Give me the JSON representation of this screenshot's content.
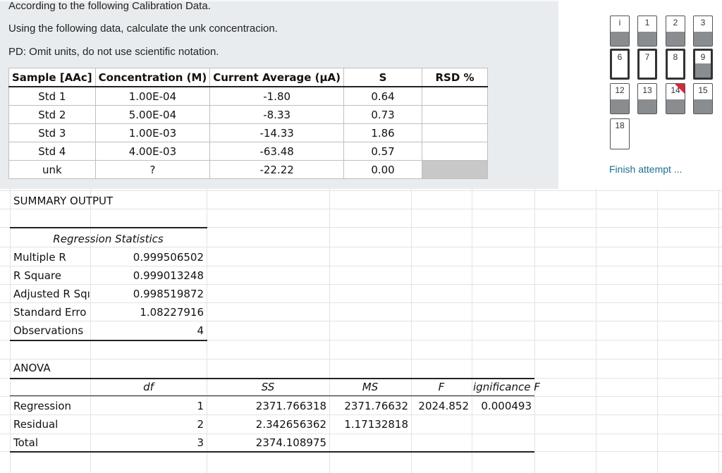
{
  "question": {
    "line1": "According to the following Calibration Data.",
    "line2": "Using the following data, calculate the  unk concentracion.",
    "line3": "PD: Omit units, do not use scientific notation."
  },
  "calibration": {
    "headers": [
      "Sample [AAc]",
      "Concentration (M)",
      "Current Average (μA)",
      "S",
      "RSD %"
    ],
    "rows": [
      [
        "Std 1",
        "1.00E-04",
        "-1.80",
        "0.64",
        ""
      ],
      [
        "Std 2",
        "5.00E-04",
        "-8.33",
        "0.73",
        ""
      ],
      [
        "Std 3",
        "1.00E-03",
        "-14.33",
        "1.86",
        ""
      ],
      [
        "Std 4",
        "4.00E-03",
        "-63.48",
        "0.57",
        ""
      ],
      [
        "unk",
        "?",
        "-22.22",
        "0.00",
        ""
      ]
    ]
  },
  "summary": {
    "title": "SUMMARY OUTPUT",
    "regression_title": "Regression Statistics",
    "stats": [
      {
        "label": "Multiple R",
        "value": "0.999506502"
      },
      {
        "label": "R Square",
        "value": "0.999013248"
      },
      {
        "label": "Adjusted R Sqı",
        "value": "0.998519872"
      },
      {
        "label": "Standard Erro",
        "value": "1.08227916"
      },
      {
        "label": "Observations",
        "value": "4"
      }
    ],
    "anova_title": "ANOVA",
    "anova_headers": {
      "df": "df",
      "ss": "SS",
      "ms": "MS",
      "f": "F",
      "sig": "ignificance F"
    },
    "anova_rows": [
      {
        "label": "Regression",
        "df": "1",
        "ss": "2371.766318",
        "ms": "2371.76632",
        "f": "2024.852",
        "sig": "0.000493"
      },
      {
        "label": "Residual",
        "df": "2",
        "ss": "2.342656362",
        "ms": "1.17132818",
        "f": "",
        "sig": ""
      },
      {
        "label": "Total",
        "df": "3",
        "ss": "2374.108975",
        "ms": "",
        "f": "",
        "sig": ""
      }
    ]
  },
  "navigation": {
    "items": [
      {
        "label": "i",
        "state": "answered"
      },
      {
        "label": "1",
        "state": "answered"
      },
      {
        "label": "2",
        "state": "answered"
      },
      {
        "label": "3",
        "state": "answered"
      },
      {
        "label": "6",
        "state": "unanswered"
      },
      {
        "label": "7",
        "state": "unanswered"
      },
      {
        "label": "8",
        "state": "unanswered"
      },
      {
        "label": "9",
        "state": "answered"
      },
      {
        "label": "12",
        "state": "answered"
      },
      {
        "label": "13",
        "state": "answered"
      },
      {
        "label": "14",
        "state": "flagged"
      },
      {
        "label": "15",
        "state": "answered"
      },
      {
        "label": "18",
        "state": "unanswered"
      }
    ],
    "finish_label": "Finish attempt ..."
  },
  "colors": {
    "panel_bg": "#e9ecef",
    "answered_fill": "#8a8d90",
    "flag": "#d9263a",
    "link": "#1d6f91",
    "rsd_unk_cell": "#c8c8c8"
  }
}
